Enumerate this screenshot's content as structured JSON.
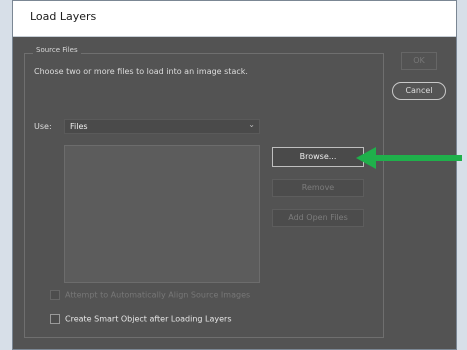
{
  "window": {
    "title": "Load Layers"
  },
  "source_files": {
    "group_label": "Source Files",
    "instructions": "Choose two or more files to load into an image stack.",
    "use_label": "Use:",
    "use_value": "Files"
  },
  "buttons": {
    "ok": "OK",
    "cancel": "Cancel",
    "browse": "Browse...",
    "remove": "Remove",
    "add_open_files": "Add Open Files"
  },
  "options": {
    "auto_align": {
      "label": "Attempt to Automatically Align Source Images",
      "checked": false,
      "enabled": false
    },
    "smart_object": {
      "label": "Create Smart Object after Loading Layers",
      "checked": false,
      "enabled": true
    }
  },
  "annotation": {
    "arrow_color": "#1fb04b"
  },
  "colors": {
    "dialog_bg": "#535353",
    "accent_arrow": "#1fb04b"
  }
}
